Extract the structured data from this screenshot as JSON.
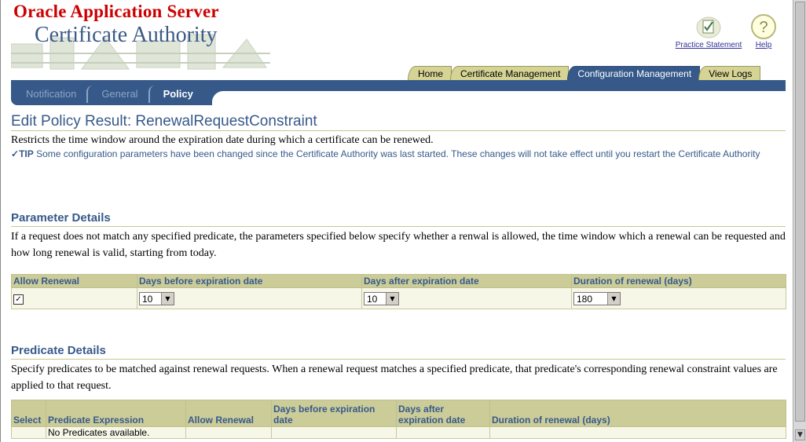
{
  "branding": {
    "company": "Oracle Application Server",
    "product": "Certificate Authority"
  },
  "global_buttons": [
    {
      "label": "Practice Statement",
      "icon": "practice-statement-icon"
    },
    {
      "label": "Help",
      "icon": "help-icon"
    }
  ],
  "tabs": [
    {
      "label": "Home",
      "active": false
    },
    {
      "label": "Certificate Management",
      "active": false
    },
    {
      "label": "Configuration Management",
      "active": true
    },
    {
      "label": "View Logs",
      "active": false
    }
  ],
  "subtabs": [
    {
      "label": "Notification",
      "active": false
    },
    {
      "label": "General",
      "active": false
    },
    {
      "label": "Policy",
      "active": true
    }
  ],
  "page": {
    "title": "Edit Policy Result: RenewalRequestConstraint",
    "description": "Restricts the time window around the expiration date during which a certificate can be renewed.",
    "tip_label": "TIP",
    "tip_text": "Some configuration parameters have been changed since the Certificate Authority was last started. These changes will not take effect until you restart the Certificate Authority"
  },
  "parameter_details": {
    "title": "Parameter Details",
    "text": "If a request does not match any specified predicate, the parameters specified below specify whether a renwal is allowed, the time window which a renewal can be requested and how long renewal is valid, starting from today.",
    "columns": [
      "Allow Renewal",
      "Days before expiration date",
      "Days after expiration date",
      "Duration of renewal (days)"
    ],
    "allow_renewal_checked": true,
    "days_before": "10",
    "days_after": "10",
    "duration": "180"
  },
  "predicate_details": {
    "title": "Predicate Details",
    "text": "Specify predicates to be matched against renewal requests. When a renewal request matches a specified predicate, that predicate's corresponding renewal constraint values are applied to that request.",
    "columns": [
      "Select",
      "Predicate Expression",
      "Allow Renewal",
      "Days before expiration date",
      "Days after expiration date",
      "Duration of renewal (days)"
    ],
    "empty_message": "No Predicates available."
  },
  "colors": {
    "brand_red": "#cc0000",
    "brand_blue": "#36598a",
    "tab_tan": "#d6d494",
    "header_tan": "#cccc99"
  }
}
